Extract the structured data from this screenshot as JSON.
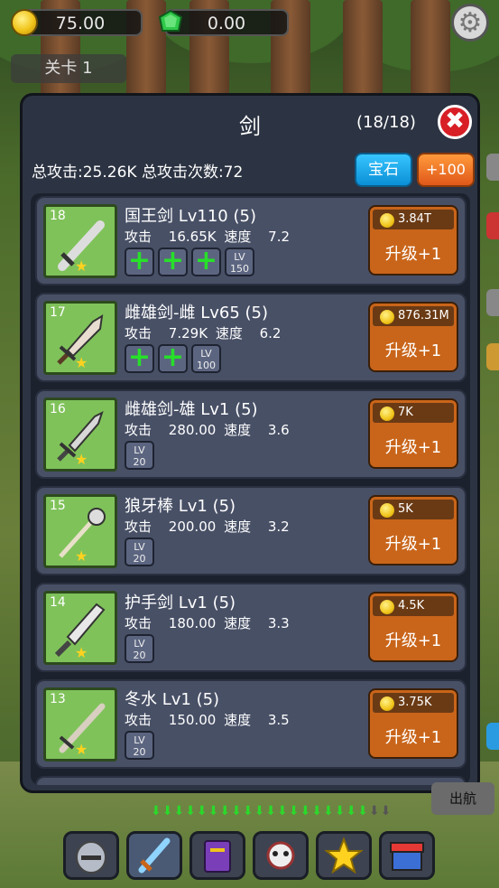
{
  "hud": {
    "gold": "75.00",
    "gems": "0.00",
    "stage_label": "关卡 1"
  },
  "panel": {
    "title": "剑",
    "count": "(18/18)",
    "close_label": "✖",
    "stats_text": "总攻击:25.26K 总攻击次数:72",
    "gem_button": "宝石",
    "plus_button": "+100"
  },
  "weapons": [
    {
      "id": "18",
      "name": "国王剑 Lv110 (5)",
      "attack_label": "攻击",
      "attack": "16.65K",
      "speed_label": "速度",
      "speed": "7.2",
      "plus_slots": 3,
      "lv_cap": "LV\n150",
      "cost": "3.84T",
      "upgrade": "升级+1"
    },
    {
      "id": "17",
      "name": "雌雄剑-雌 Lv65 (5)",
      "attack_label": "攻击",
      "attack": "7.29K",
      "speed_label": "速度",
      "speed": "6.2",
      "plus_slots": 2,
      "lv_cap": "LV\n100",
      "cost": "876.31M",
      "upgrade": "升级+1"
    },
    {
      "id": "16",
      "name": "雌雄剑-雄 Lv1 (5)",
      "attack_label": "攻击",
      "attack": "280.00",
      "speed_label": "速度",
      "speed": "3.6",
      "plus_slots": 0,
      "lv_cap": "LV\n20",
      "cost": "7K",
      "upgrade": "升级+1"
    },
    {
      "id": "15",
      "name": "狼牙棒 Lv1 (5)",
      "attack_label": "攻击",
      "attack": "200.00",
      "speed_label": "速度",
      "speed": "3.2",
      "plus_slots": 0,
      "lv_cap": "LV\n20",
      "cost": "5K",
      "upgrade": "升级+1"
    },
    {
      "id": "14",
      "name": "护手剑 Lv1 (5)",
      "attack_label": "攻击",
      "attack": "180.00",
      "speed_label": "速度",
      "speed": "3.3",
      "plus_slots": 0,
      "lv_cap": "LV\n20",
      "cost": "4.5K",
      "upgrade": "升级+1"
    },
    {
      "id": "13",
      "name": "冬水 Lv1 (5)",
      "attack_label": "攻击",
      "attack": "150.00",
      "speed_label": "速度",
      "speed": "3.5",
      "plus_slots": 0,
      "lv_cap": "LV\n20",
      "cost": "3.75K",
      "upgrade": "升级+1"
    }
  ],
  "bottom": {
    "exit_label": "出航",
    "tabs": [
      "helmet-icon",
      "sword-icon",
      "spellbook-icon",
      "skull-icon",
      "star-icon",
      "shop-icon"
    ]
  },
  "colors": {
    "panel": "#2c3342",
    "item": "#485066",
    "thumb": "#7fc25a",
    "upgrade": "#c9651a",
    "gem_button": "#0a8fd6",
    "plus_button": "#e0581a",
    "close_button": "#d81f26"
  }
}
